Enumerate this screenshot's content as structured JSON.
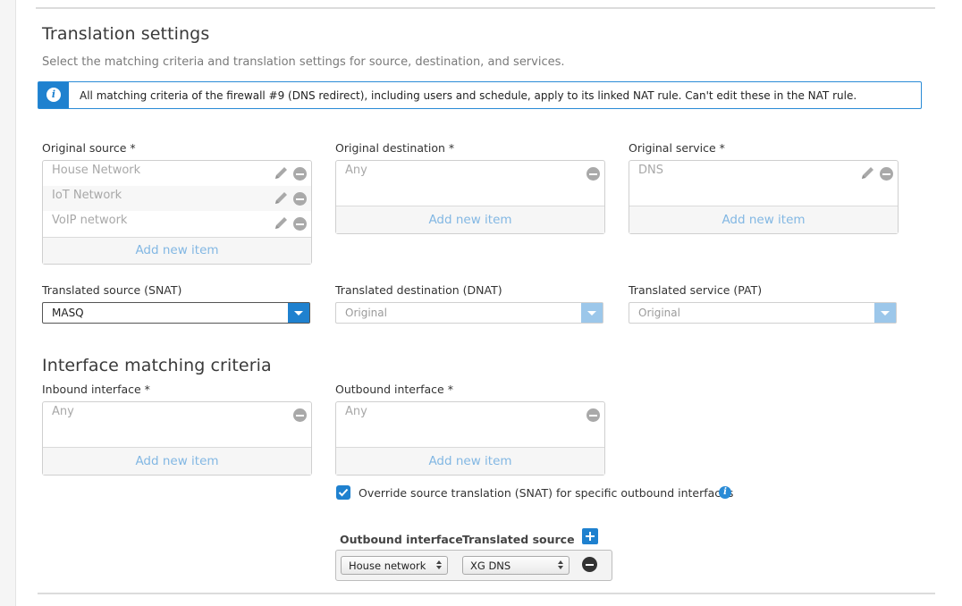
{
  "translation": {
    "title": "Translation settings",
    "description": "Select the matching criteria and translation settings for source, destination, and services.",
    "info_message": "All matching criteria of the firewall #9 (DNS redirect), including users and schedule, apply to its linked NAT rule. Can't edit these in the NAT rule."
  },
  "original_source": {
    "label": "Original source *",
    "items": [
      "House Network",
      "IoT Network",
      "VoIP network"
    ],
    "add_label": "Add new item"
  },
  "original_destination": {
    "label": "Original destination *",
    "items": [
      "Any"
    ],
    "add_label": "Add new item"
  },
  "original_service": {
    "label": "Original service *",
    "items": [
      "DNS"
    ],
    "add_label": "Add new item"
  },
  "translated_source": {
    "label": "Translated source (SNAT)",
    "value": "MASQ"
  },
  "translated_destination": {
    "label": "Translated destination (DNAT)",
    "value": "Original"
  },
  "translated_service": {
    "label": "Translated service (PAT)",
    "value": "Original"
  },
  "interface": {
    "title": "Interface matching criteria",
    "inbound": {
      "label": "Inbound interface *",
      "items": [
        "Any"
      ],
      "add_label": "Add new item"
    },
    "outbound": {
      "label": "Outbound interface *",
      "items": [
        "Any"
      ],
      "add_label": "Add new item"
    },
    "override_label": "Override source translation (SNAT) for specific outbound interfaces",
    "override_checked": true
  },
  "override_table": {
    "col_outbound": "Outbound interface",
    "col_translated": "Translated source",
    "rows": [
      {
        "outbound": "House network",
        "translated": "XG DNS"
      }
    ]
  },
  "colors": {
    "accent": "#1f81cf",
    "link": "#82b7e3",
    "muted_text": "#a8a8a8"
  },
  "icons": [
    "info-icon",
    "pencil-icon",
    "remove-icon",
    "dropdown-arrow-icon",
    "checkbox-checked-icon",
    "plus-icon"
  ]
}
